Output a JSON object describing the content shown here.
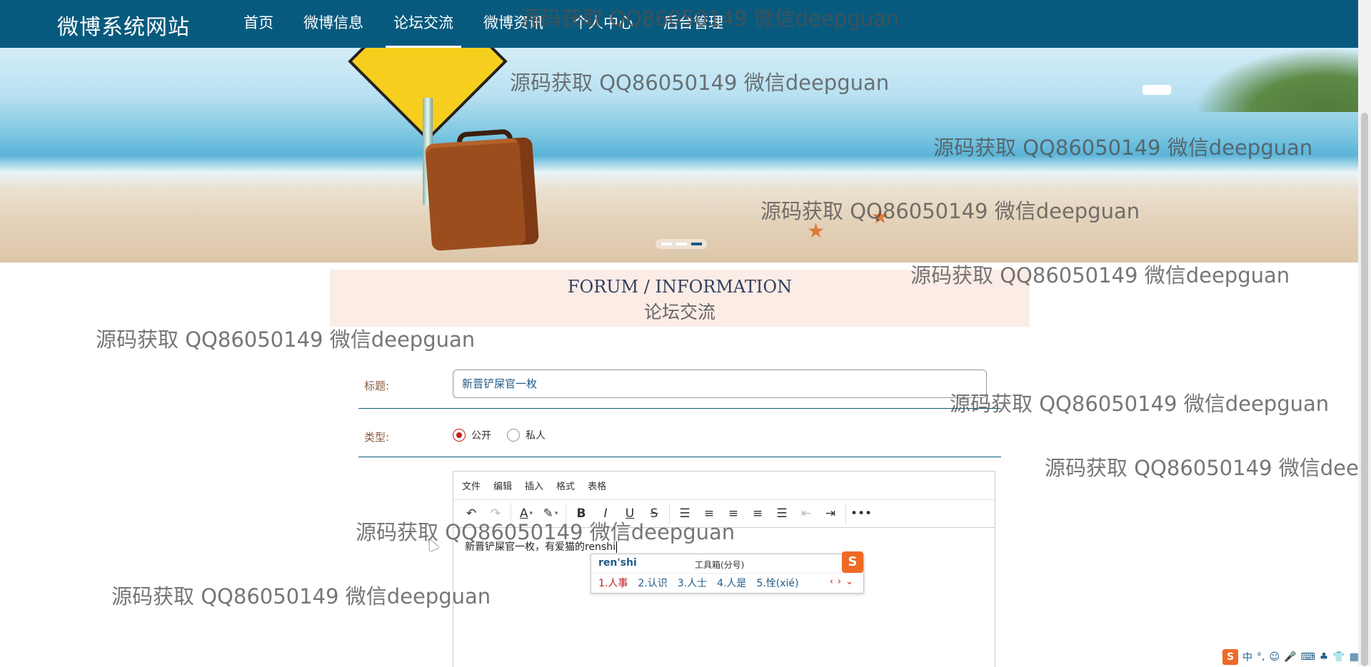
{
  "nav": {
    "brand": "微博系统网站",
    "items": [
      {
        "label": "首页"
      },
      {
        "label": "微博信息"
      },
      {
        "label": "论坛交流"
      },
      {
        "label": "微博资讯"
      },
      {
        "label": "个人中心"
      },
      {
        "label": "后台管理"
      }
    ],
    "active_index": 2
  },
  "section": {
    "title_en": "FORUM / INFORMATION",
    "title_cn": "论坛交流"
  },
  "form": {
    "title_label": "标题:",
    "title_value": "新晋铲屎官一枚",
    "type_label": "类型:",
    "type_options": [
      "公开",
      "私人"
    ],
    "type_selected": "公开"
  },
  "editor": {
    "menu": [
      "文件",
      "编辑",
      "插入",
      "格式",
      "表格"
    ],
    "toolbar_icons": [
      "undo-icon",
      "redo-icon",
      "font-color-icon",
      "highlight-icon",
      "bold-icon",
      "italic-icon",
      "underline-icon",
      "strikethrough-icon",
      "list-icon",
      "align-left-icon",
      "align-center-icon",
      "align-right-icon",
      "align-justify-icon",
      "outdent-icon",
      "indent-icon",
      "more-icon"
    ],
    "content": "新晋铲屎官一枚，有爱猫的renshi"
  },
  "ime": {
    "pinyin": "ren'shi",
    "tools": "工具箱(分号)",
    "candidates": [
      "1.人事",
      "2.认识",
      "3.人士",
      "4.人是",
      "5.恮(xié)"
    ]
  },
  "tray": {
    "input_mode": "中",
    "punct": "°,"
  },
  "watermark": "源码获取 QQ86050149 微信deepguan",
  "watermark_partial": "源码获取 QQ86050149 微信deep",
  "colors": {
    "nav_bg": "#075a7e",
    "heading_bg": "#fbece6",
    "accent_red": "#c02020",
    "link_blue": "#1f5a87"
  }
}
